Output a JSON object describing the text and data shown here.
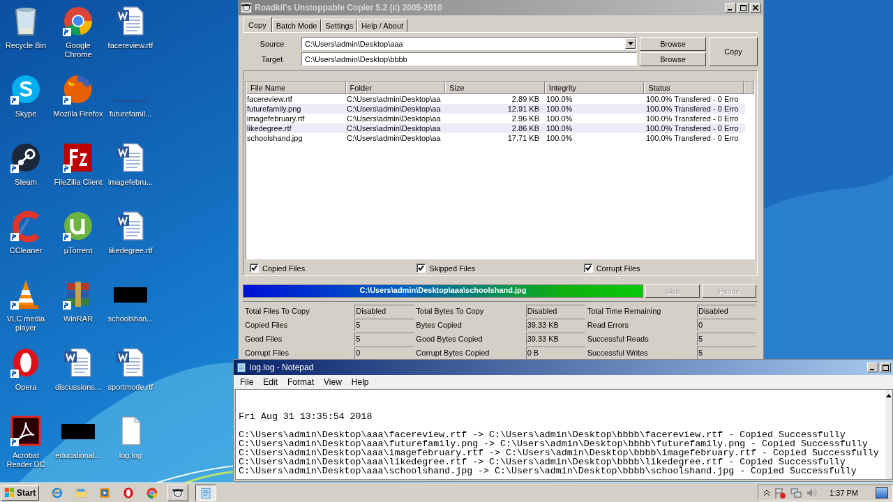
{
  "desktop_icons": [
    {
      "label": "Recycle Bin",
      "kind": "recycle",
      "shortcut": false
    },
    {
      "label": "Google Chrome",
      "kind": "chrome",
      "shortcut": true
    },
    {
      "label": "facereview.rtf",
      "kind": "word",
      "shortcut": false
    },
    {
      "label": "Skype",
      "kind": "skype",
      "shortcut": true
    },
    {
      "label": "Mozilla Firefox",
      "kind": "firefox",
      "shortcut": true
    },
    {
      "label": "futurefamil...",
      "kind": "thinimage",
      "shortcut": false
    },
    {
      "label": "Steam",
      "kind": "steam",
      "shortcut": true
    },
    {
      "label": "FileZilla Client",
      "kind": "filezilla",
      "shortcut": true
    },
    {
      "label": "imagefebru...",
      "kind": "word",
      "shortcut": false
    },
    {
      "label": "CCleaner",
      "kind": "ccleaner",
      "shortcut": true
    },
    {
      "label": "µTorrent",
      "kind": "utorrent",
      "shortcut": true
    },
    {
      "label": "likedegree.rtf",
      "kind": "word",
      "shortcut": false
    },
    {
      "label": "VLC media player",
      "kind": "vlc",
      "shortcut": true
    },
    {
      "label": "WinRAR",
      "kind": "winrar",
      "shortcut": true
    },
    {
      "label": "schoolshan...",
      "kind": "blackimage",
      "shortcut": false
    },
    {
      "label": "Opera",
      "kind": "opera",
      "shortcut": true
    },
    {
      "label": "discussions...",
      "kind": "word",
      "shortcut": false
    },
    {
      "label": "sportmode.rtf",
      "kind": "word",
      "shortcut": false
    },
    {
      "label": "Acrobat Reader DC",
      "kind": "acrobat",
      "shortcut": true
    },
    {
      "label": "educational...",
      "kind": "blackimage",
      "shortcut": false
    },
    {
      "label": "log.log",
      "kind": "textfile",
      "shortcut": false
    }
  ],
  "copier": {
    "title": "Roadkil's Unstoppable Copier 5.2 (c) 2005-2010",
    "tabs": [
      {
        "label": "Copy",
        "selected": true
      },
      {
        "label": "Batch Mode",
        "selected": false
      },
      {
        "label": "Settings",
        "selected": false
      },
      {
        "label": "Help / About",
        "selected": false
      }
    ],
    "source_label": "Source",
    "source": "C:\\Users\\admin\\Desktop\\aaa",
    "target_label": "Target",
    "target": "C:\\Users\\admin\\Desktop\\bbbb",
    "browse_buttons": [
      "Browse",
      "Browse"
    ],
    "copy_button": "Copy",
    "table": {
      "columns": [
        "File Name",
        "Folder",
        "Size",
        "Integrity",
        "Status"
      ],
      "rows": [
        [
          "facereview.rtf",
          "C:\\Users\\admin\\Desktop\\aa",
          "2.89 KB",
          "100.0%",
          "100.0% Transfered - 0 Erro"
        ],
        [
          "futurefamily.png",
          "C:\\Users\\admin\\Desktop\\aa",
          "12.91 KB",
          "100.0%",
          "100.0% Transfered - 0 Erro"
        ],
        [
          "imagefebruary.rtf",
          "C:\\Users\\admin\\Desktop\\aa",
          "2.96 KB",
          "100.0%",
          "100.0% Transfered - 0 Erro"
        ],
        [
          "likedegree.rtf",
          "C:\\Users\\admin\\Desktop\\aa",
          "2.86 KB",
          "100.0%",
          "100.0% Transfered - 0 Erro"
        ],
        [
          "schoolshand.jpg",
          "C:\\Users\\admin\\Desktop\\aa",
          "17.71 KB",
          "100.0%",
          "100.0% Transfered - 0 Erro"
        ]
      ]
    },
    "filters": [
      {
        "label": "Copied Files",
        "checked": true
      },
      {
        "label": "Skipped Files",
        "checked": true
      },
      {
        "label": "Corrupt Files",
        "checked": true
      }
    ],
    "progress": {
      "text": "C:\\Users\\admin\\Desktop\\aaa\\schoolshand.jpg",
      "level": 1
    },
    "actions": [
      {
        "label": "Skip",
        "disabled": true
      },
      {
        "label": "Pause",
        "disabled": true
      }
    ],
    "stats": [
      [
        {
          "label": "Total Files To Copy",
          "value": "Disabled"
        },
        {
          "label": "Copied Files",
          "value": "5"
        },
        {
          "label": "Good Files",
          "value": "5"
        },
        {
          "label": "Corrupt Files",
          "value": "0"
        }
      ],
      [
        {
          "label": "Total Bytes To Copy",
          "value": "Disabled"
        },
        {
          "label": "Bytes Copied",
          "value": "39.33 KB"
        },
        {
          "label": "Good Bytes Copied",
          "value": "39.33 KB"
        },
        {
          "label": "Corrupt Bytes Copied",
          "value": "0 B"
        }
      ],
      [
        {
          "label": "Total Time Remaining",
          "value": "Disabled"
        },
        {
          "label": "Read Errors",
          "value": "0"
        },
        {
          "label": "Successful Reads",
          "value": "5"
        },
        {
          "label": "Successful Writes",
          "value": "5"
        }
      ]
    ]
  },
  "notepad": {
    "title": "log.log - Notepad",
    "menu": [
      "File",
      "Edit",
      "Format",
      "View",
      "Help"
    ],
    "date_line": "Fri Aug 31 13:35:54 2018",
    "lines": [
      "C:\\Users\\admin\\Desktop\\aaa\\facereview.rtf -> C:\\Users\\admin\\Desktop\\bbbb\\facereview.rtf - Copied Successfully",
      "C:\\Users\\admin\\Desktop\\aaa\\futurefamily.png -> C:\\Users\\admin\\Desktop\\bbbb\\futurefamily.png - Copied Successfully",
      "C:\\Users\\admin\\Desktop\\aaa\\imagefebruary.rtf -> C:\\Users\\admin\\Desktop\\bbbb\\imagefebruary.rtf - Copied Successfully",
      "C:\\Users\\admin\\Desktop\\aaa\\likedegree.rtf -> C:\\Users\\admin\\Desktop\\bbbb\\likedegree.rtf - Copied Successfully",
      "C:\\Users\\admin\\Desktop\\aaa\\schoolshand.jpg -> C:\\Users\\admin\\Desktop\\bbbb\\schoolshand.jpg - Copied Successfully"
    ]
  },
  "taskbar": {
    "start": "Start",
    "apps": [
      {
        "kind": "ie",
        "selected": false
      },
      {
        "kind": "folder",
        "selected": false
      },
      {
        "kind": "media",
        "selected": false
      },
      {
        "kind": "opera",
        "selected": false
      },
      {
        "kind": "chrome",
        "selected": false
      },
      {
        "kind": "copier",
        "selected": false
      },
      {
        "kind": "notepad",
        "selected": true
      }
    ],
    "time": "1:37 PM"
  }
}
